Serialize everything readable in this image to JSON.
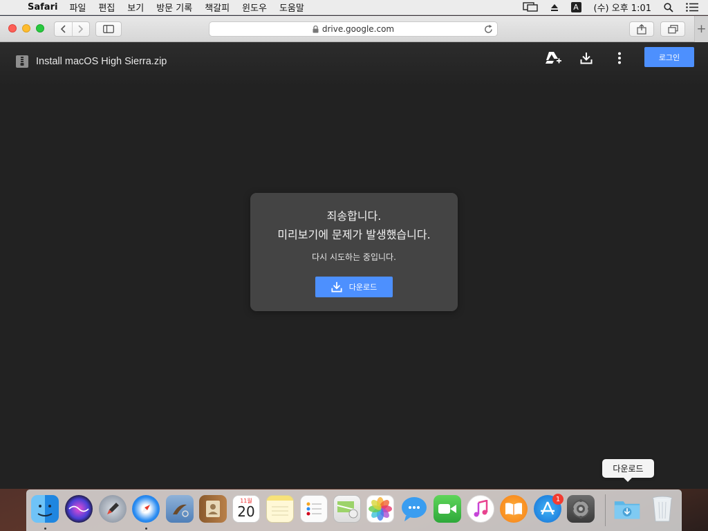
{
  "menubar": {
    "apple_glyph": "",
    "app_name": "Safari",
    "items": [
      "파일",
      "편집",
      "보기",
      "방문 기록",
      "책갈피",
      "윈도우",
      "도움말"
    ],
    "input_badge": "A",
    "clock": "(수) 오후 1:01"
  },
  "browser": {
    "url": "drive.google.com",
    "new_tab_label": "+"
  },
  "viewer": {
    "file_title": "Install macOS High Sierra.zip",
    "login_label": "로그인",
    "error_line1": "죄송합니다.",
    "error_line2": "미리보기에 문제가 발생했습니다.",
    "error_sub": "다시 시도하는 중입니다.",
    "download_label": "다운로드"
  },
  "dock": {
    "calendar_month": "11월",
    "calendar_day": "20",
    "app_store_badge": "1",
    "tooltip": "다운로드"
  },
  "colors": {
    "accent_blue": "#4d90fe",
    "viewer_bg": "#222222",
    "card_bg": "#444444"
  }
}
